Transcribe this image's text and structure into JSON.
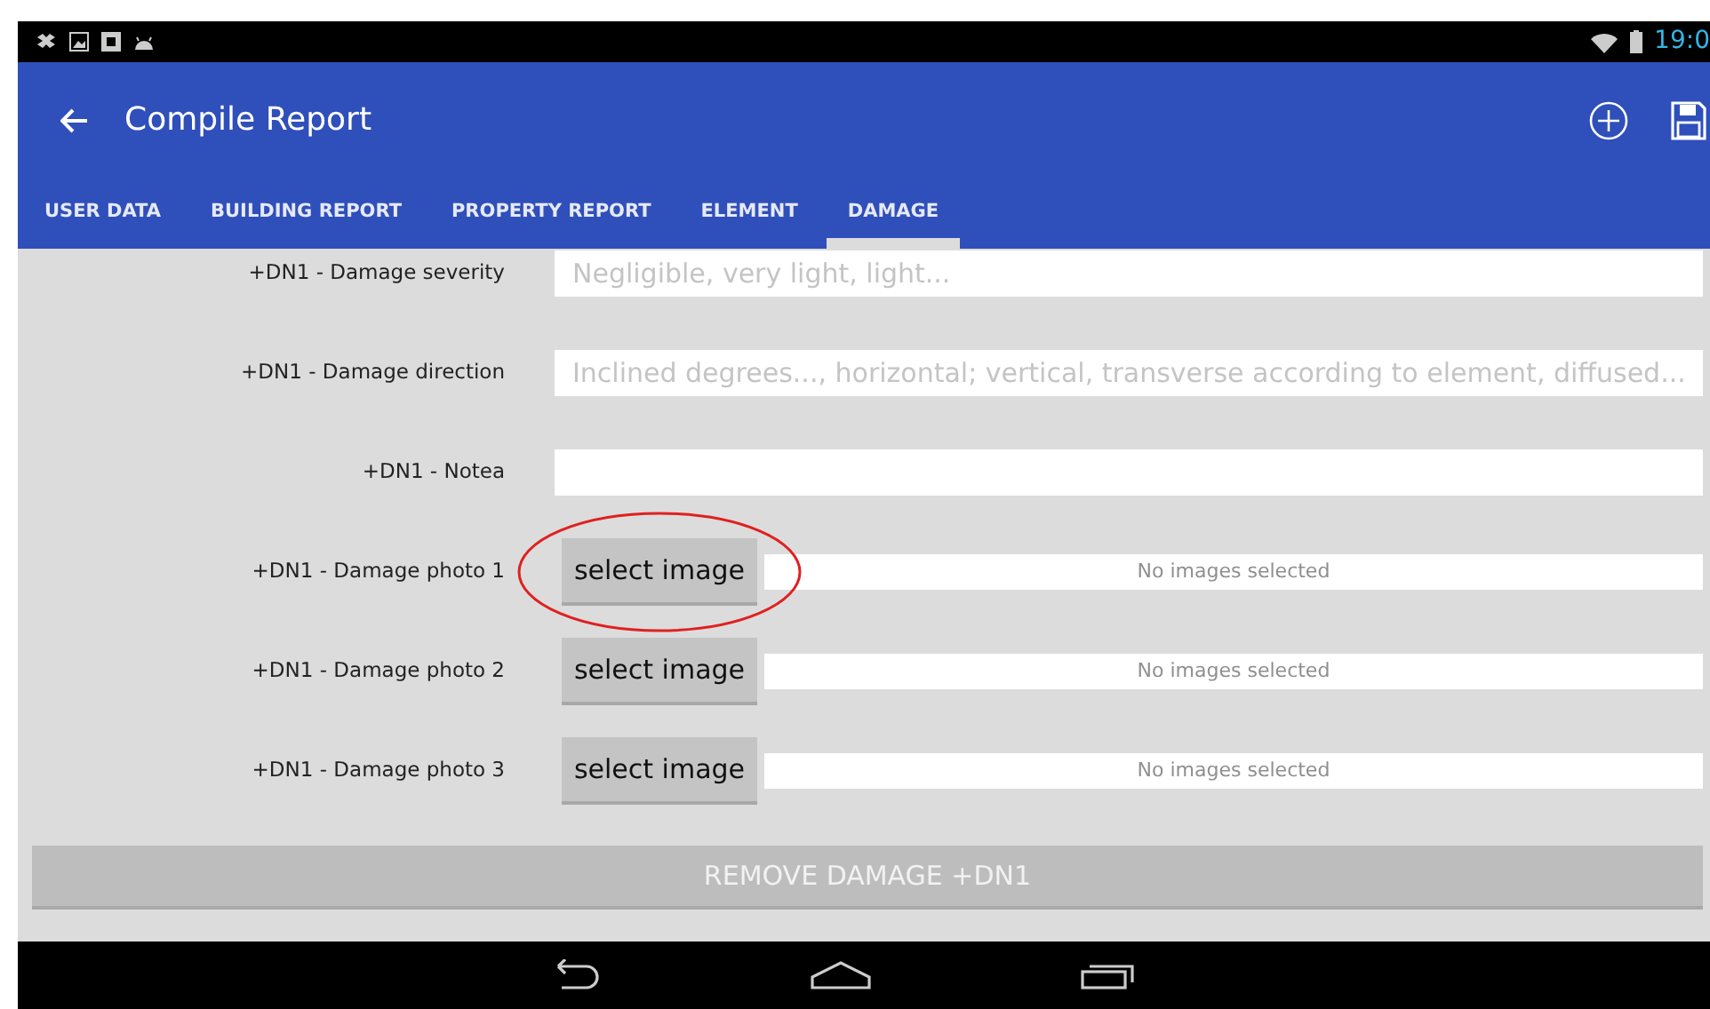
{
  "status_bar": {
    "time": "19:0"
  },
  "app_bar": {
    "title": "Compile Report"
  },
  "tabs": [
    {
      "label": "USER DATA",
      "selected": false
    },
    {
      "label": "BUILDING REPORT",
      "selected": false
    },
    {
      "label": "PROPERTY REPORT",
      "selected": false
    },
    {
      "label": "ELEMENT",
      "selected": false
    },
    {
      "label": "DAMAGE",
      "selected": true
    }
  ],
  "fields": [
    {
      "kind": "text",
      "label": "+DN1 - Damage severity",
      "placeholder": "Negligible, very light, light..."
    },
    {
      "kind": "text",
      "label": "+DN1 - Damage direction",
      "placeholder": "Inclined degrees..., horizontal; vertical, transverse according to element, diffused..."
    },
    {
      "kind": "text",
      "label": "+DN1 - Notea"
    },
    {
      "kind": "image",
      "label": "+DN1 - Damage photo 1",
      "button": "select image",
      "status": "No images selected",
      "highlighted": true
    },
    {
      "kind": "image",
      "label": "+DN1 - Damage photo 2",
      "button": "select image",
      "status": "No images selected",
      "highlighted": false
    },
    {
      "kind": "image",
      "label": "+DN1 - Damage photo 3",
      "button": "select image",
      "status": "No images selected",
      "highlighted": false
    }
  ],
  "remove_button": {
    "label": "REMOVE DAMAGE +DN1",
    "disabled": true
  }
}
